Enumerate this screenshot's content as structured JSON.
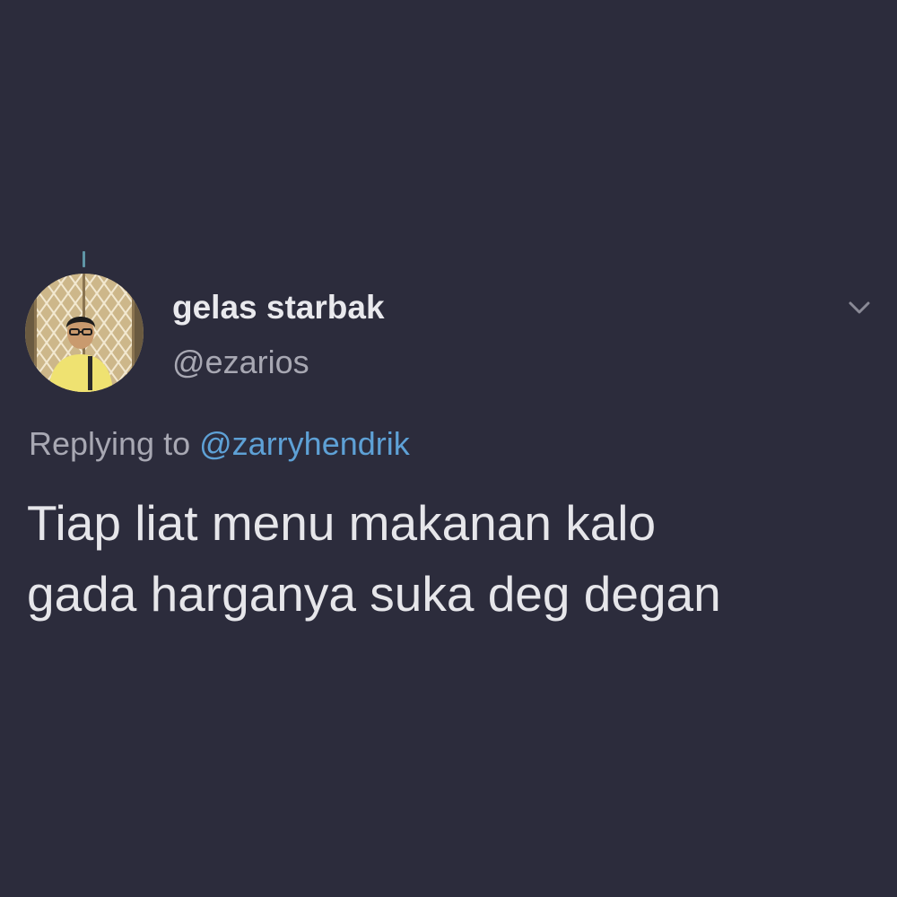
{
  "colors": {
    "background": "#2c2c3c",
    "primary_text": "#e9e9ed",
    "secondary_text": "#a8a8b3",
    "link": "#5ea1d6",
    "thread_line": "#5f95a6"
  },
  "tweet": {
    "author": {
      "display_name": "gelas starbak",
      "handle": "@ezarios",
      "avatar_icon": "profile-photo-icon"
    },
    "reply": {
      "prefix": "Replying to",
      "mention": "@zarryhendrik"
    },
    "text_lines": [
      "Tiap liat menu makanan kalo",
      "gada harganya suka deg degan"
    ],
    "menu_icon": "chevron-down-icon"
  }
}
